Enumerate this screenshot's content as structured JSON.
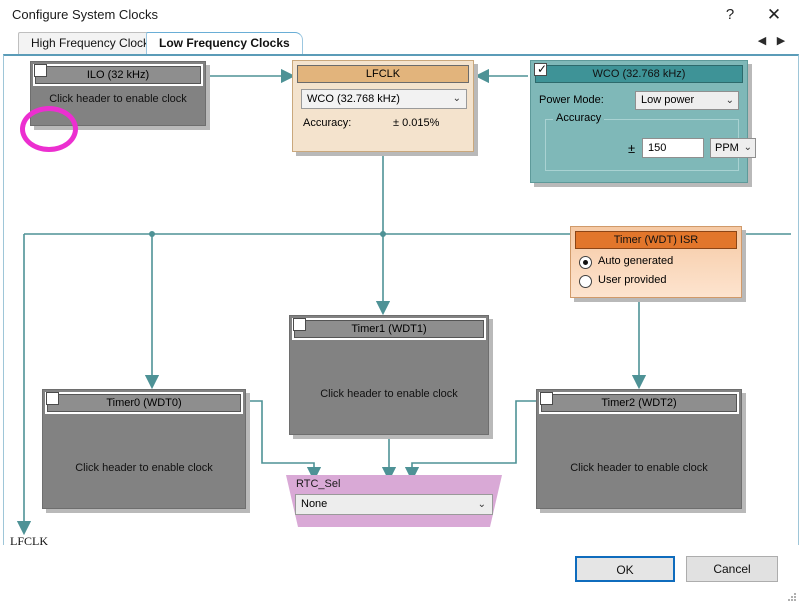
{
  "window": {
    "title": "Configure System Clocks",
    "help_icon": "?",
    "close_icon": "✕"
  },
  "tabs": {
    "items": [
      {
        "label": "High Frequency Clocks",
        "active": false
      },
      {
        "label": "Low Frequency Clocks",
        "active": true
      }
    ],
    "scroll_left_icon": "◀",
    "scroll_right_icon": "▶"
  },
  "blocks": {
    "ilo": {
      "header": "ILO (32 kHz)",
      "checked": false,
      "body_text": "Click header to enable clock"
    },
    "lfclk": {
      "header": "LFCLK",
      "source_value": "WCO (32.768 kHz)",
      "accuracy_label": "Accuracy:",
      "accuracy_value": "± 0.015%",
      "dropdown_icon": "⌄"
    },
    "wco": {
      "header": "WCO (32.768 kHz)",
      "checked": true,
      "check_glyph": "✓",
      "power_mode_label": "Power Mode:",
      "power_mode_value": "Low power",
      "accuracy_group_label": "Accuracy",
      "plusminus": "±",
      "accuracy_value": "150",
      "accuracy_unit": "PPM",
      "dropdown_icon": "⌄"
    },
    "isr": {
      "header": "Timer (WDT) ISR",
      "options": [
        {
          "label": "Auto generated",
          "selected": true
        },
        {
          "label": "User provided",
          "selected": false
        }
      ]
    },
    "timer0": {
      "header": "Timer0 (WDT0)",
      "checked": false,
      "body_text": "Click header to enable clock"
    },
    "timer1": {
      "header": "Timer1 (WDT1)",
      "checked": false,
      "body_text": "Click header to enable clock"
    },
    "timer2": {
      "header": "Timer2 (WDT2)",
      "checked": false,
      "body_text": "Click header to enable clock"
    },
    "rtc_sel": {
      "label": "RTC_Sel",
      "value": "None",
      "dropdown_icon": "⌄"
    },
    "output_label": "LFCLK"
  },
  "footer": {
    "ok_label": "OK",
    "cancel_label": "Cancel"
  },
  "colors": {
    "wire": "#4e9296",
    "lfclk_header": "#e2b47c",
    "wco_header": "#3e9397",
    "isr_header": "#e2762b",
    "rtc_fill": "#d9a9d6",
    "annotation": "#ec2fd0",
    "disabled_block": "#828282",
    "ok_focus_border": "#0f6cbd"
  }
}
